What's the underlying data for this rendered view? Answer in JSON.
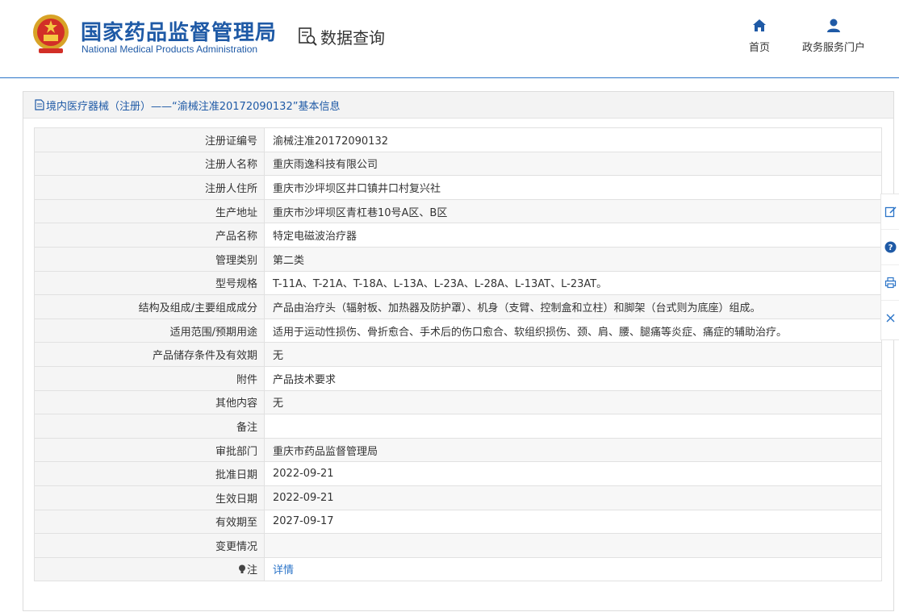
{
  "header": {
    "org_name_cn": "国家药品监督管理局",
    "org_name_en": "National Medical Products Administration",
    "query_label": "数据查询",
    "nav": {
      "home": "首页",
      "portal": "政务服务门户"
    }
  },
  "panel": {
    "title": "境内医疗器械（注册）——“渝械注准20172090132”基本信息"
  },
  "rows": [
    {
      "label": "注册证编号",
      "value": "渝械注准20172090132"
    },
    {
      "label": "注册人名称",
      "value": "重庆雨逸科技有限公司"
    },
    {
      "label": "注册人住所",
      "value": "重庆市沙坪坝区井口镇井口村复兴社"
    },
    {
      "label": "生产地址",
      "value": "重庆市沙坪坝区青杠巷10号A区、B区"
    },
    {
      "label": "产品名称",
      "value": "特定电磁波治疗器"
    },
    {
      "label": "管理类别",
      "value": "第二类"
    },
    {
      "label": "型号规格",
      "value": "T-11A、T-21A、T-18A、L-13A、L-23A、L-28A、L-13AT、L-23AT。"
    },
    {
      "label": "结构及组成/主要组成成分",
      "value": "产品由治疗头（辐射板、加热器及防护罩）、机身（支臂、控制盒和立柱）和脚架（台式则为底座）组成。"
    },
    {
      "label": "适用范围/预期用途",
      "value": "适用于运动性损伤、骨折愈合、手术后的伤口愈合、软组织损伤、颈、肩、腰、腿痛等炎症、痛症的辅助治疗。"
    },
    {
      "label": "产品储存条件及有效期",
      "value": "无"
    },
    {
      "label": "附件",
      "value": "产品技术要求"
    },
    {
      "label": "其他内容",
      "value": "无"
    },
    {
      "label": "备注",
      "value": ""
    },
    {
      "label": "审批部门",
      "value": "重庆市药品监督管理局"
    },
    {
      "label": "批准日期",
      "value": "2022-09-21"
    },
    {
      "label": "生效日期",
      "value": "2022-09-21"
    },
    {
      "label": "有效期至",
      "value": "2027-09-17"
    },
    {
      "label": "变更情况",
      "value": ""
    }
  ],
  "note_row": {
    "label": "注",
    "link": "详情"
  },
  "side_toolbar": [
    "edit-icon",
    "help-icon",
    "print-icon",
    "close-icon"
  ],
  "colors": {
    "brand_blue": "#1f5aa6",
    "link_blue": "#2b74c8"
  }
}
